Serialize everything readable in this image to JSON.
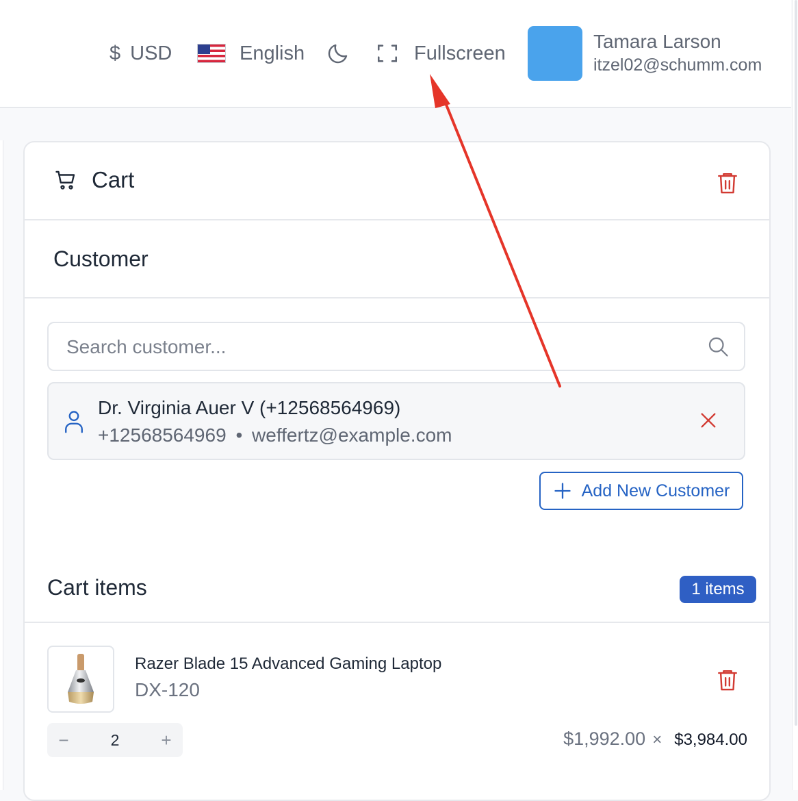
{
  "header": {
    "currency": {
      "symbol": "$",
      "code": "USD"
    },
    "language": "English",
    "theme_icon": "moon-icon",
    "fullscreen_label": "Fullscreen",
    "user": {
      "name": "Tamara Larson",
      "email": "itzel02@schumm.com",
      "avatar_color": "#4aa3ec"
    }
  },
  "cart": {
    "title": "Cart",
    "customer_section": {
      "title": "Customer",
      "search_placeholder": "Search customer...",
      "selected": {
        "name": "Dr. Virginia Auer V (+12568564969)",
        "phone": "+12568564969",
        "separator": "•",
        "email": "weffertz@example.com"
      },
      "add_button_label": "Add New Customer"
    },
    "items_section": {
      "title": "Cart items",
      "count_badge": "1 items",
      "items": [
        {
          "name": "Razer Blade 15 Advanced Gaming Laptop",
          "sku": "DX-120",
          "quantity": "2",
          "unit_price": "$1,992.00",
          "multiply": "×",
          "line_total": "$3,984.00"
        }
      ]
    }
  },
  "colors": {
    "accent": "#2563c4",
    "badge": "#2f5fc4",
    "danger": "#d23a32",
    "annotation_arrow": "#e53529"
  }
}
